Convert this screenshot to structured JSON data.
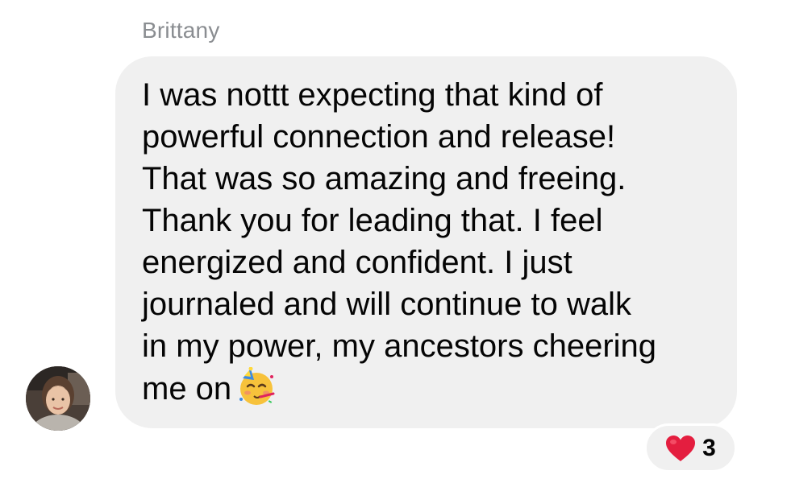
{
  "sender": {
    "name": "Brittany",
    "avatar_icon": "profile-photo"
  },
  "message": {
    "text": "I was nottt expecting that kind of\npowerful connection and release!\nThat was so amazing and freeing.\nThank you for leading that. I feel\nenergized and confident. I just\njournaled and will continue to walk\nin my power, my ancestors cheering\nme on",
    "emoji_icon": "partying-face-icon",
    "bubble_color": "#f0f0f0"
  },
  "reaction": {
    "icon": "red-heart-icon",
    "count": "3",
    "color": "#e41e3f"
  }
}
